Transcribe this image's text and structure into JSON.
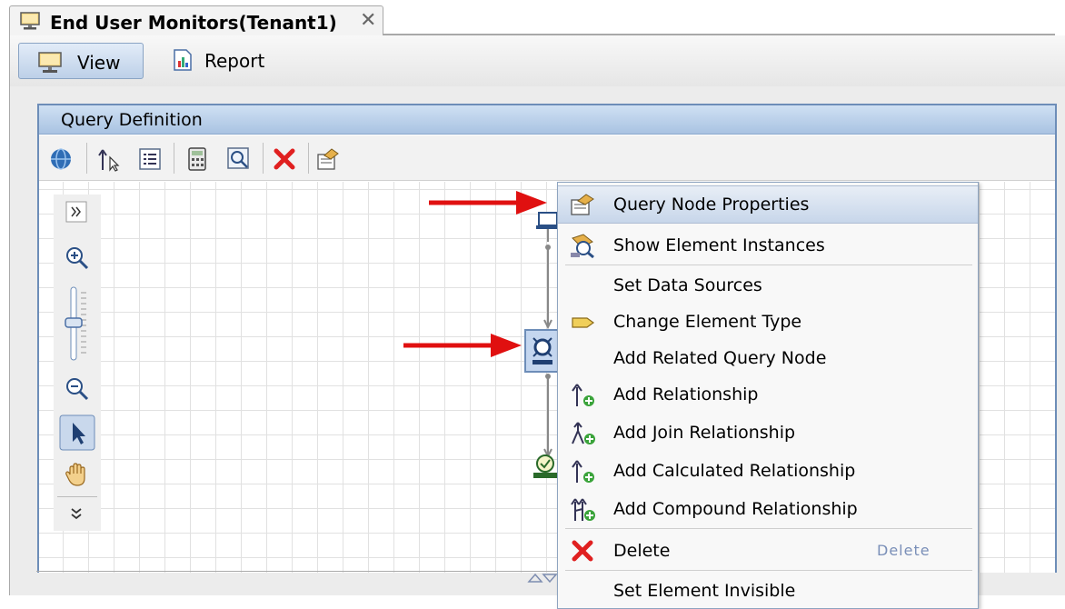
{
  "tab": {
    "title": "End User Monitors(Tenant1)",
    "close": "✕",
    "icon": "monitor-icon"
  },
  "toolbar": {
    "view_label": "View",
    "report_label": "Report"
  },
  "panel": {
    "title": "Query Definition"
  },
  "context_menu": {
    "items": [
      {
        "label": "Query Node Properties",
        "icon": "properties-icon",
        "highlighted": true
      },
      {
        "label": "Show Element Instances",
        "icon": "element-instances-icon"
      },
      {
        "label": "Set Data Sources",
        "icon": ""
      },
      {
        "label": "Change Element Type",
        "icon": "change-type-icon"
      },
      {
        "label": "Add Related Query Node",
        "icon": ""
      },
      {
        "label": "Add Relationship",
        "icon": "add-relationship-icon"
      },
      {
        "label": "Add Join Relationship",
        "icon": "add-join-relationship-icon"
      },
      {
        "label": "Add Calculated Relationship",
        "icon": "add-calculated-relationship-icon"
      },
      {
        "label": "Add Compound Relationship",
        "icon": "add-compound-relationship-icon"
      },
      {
        "label": "Delete",
        "icon": "delete-icon",
        "shortcut": "Delete"
      },
      {
        "label": "Set Element Invisible",
        "icon": ""
      }
    ]
  },
  "colors": {
    "accent": "#6d8db8",
    "arrow": "#e01010",
    "delete": "#e02020"
  }
}
